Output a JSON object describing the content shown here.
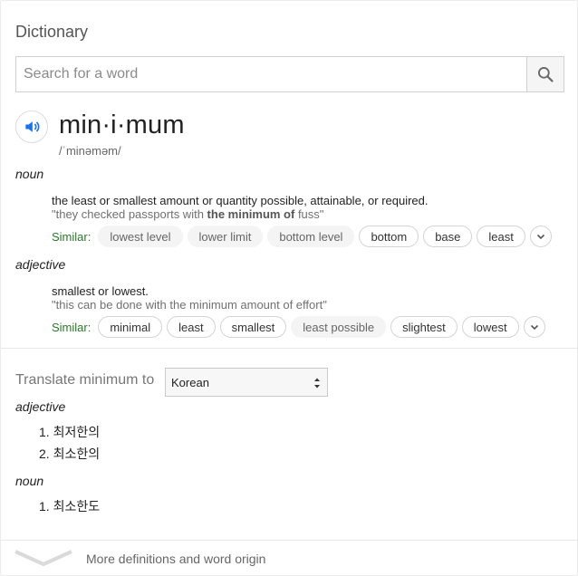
{
  "panel": {
    "title": "Dictionary"
  },
  "search": {
    "placeholder": "Search for a word",
    "value": ""
  },
  "entry": {
    "word": "min·i·mum",
    "phonetic": "/ˈminəməm/",
    "senses": [
      {
        "pos": "noun",
        "definition": "the least or smallest amount or quantity possible, attainable, or required.",
        "example_before": "\"they checked passports with ",
        "example_bold": "the minimum of",
        "example_after": " fuss\"",
        "similar_label": "Similar:",
        "similar": [
          "lowest level",
          "lower limit",
          "bottom level",
          "bottom",
          "base",
          "least"
        ],
        "similar_soft": [
          true,
          true,
          true,
          false,
          false,
          false
        ]
      },
      {
        "pos": "adjective",
        "definition": "smallest or lowest.",
        "example": "\"this can be done with the minimum amount of effort\"",
        "similar_label": "Similar:",
        "similar": [
          "minimal",
          "least",
          "smallest",
          "least possible",
          "slightest",
          "lowest"
        ],
        "similar_soft": [
          false,
          false,
          false,
          true,
          false,
          false
        ]
      }
    ]
  },
  "translate": {
    "label": "Translate minimum to",
    "language": "Korean",
    "groups": [
      {
        "pos": "adjective",
        "items": [
          "1. 최저한의",
          "2. 최소한의"
        ]
      },
      {
        "pos": "noun",
        "items": [
          "1. 최소한도"
        ]
      }
    ]
  },
  "footer": {
    "more_label": "More definitions and word origin"
  },
  "colors": {
    "accent": "#1a73e8",
    "similar": "#2a7a2a"
  },
  "icons": {
    "search": "search-icon",
    "speaker": "speaker-icon",
    "expand": "chevron-down-icon"
  }
}
